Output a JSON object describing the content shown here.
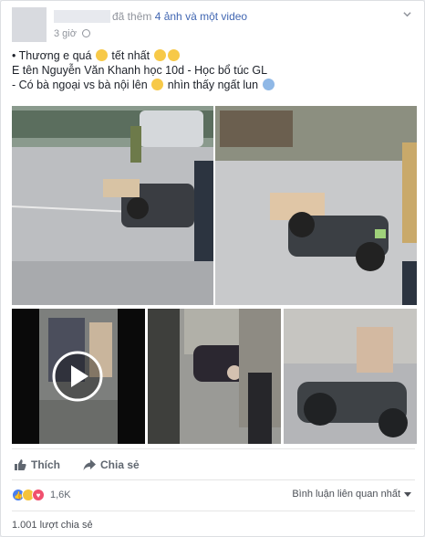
{
  "header": {
    "action_text": "đã thêm",
    "action_link": "4 ảnh và một video",
    "time": "3 giờ"
  },
  "post": {
    "line1_a": "• Thương e quá",
    "line1_b": "tết nhất",
    "line2": "E tên Nguyễn Văn Khanh học 10d - Học bổ túc GL",
    "line3_a": "- Có bà ngoại vs bà nội lên",
    "line3_b": "nhìn thấy ngất lun"
  },
  "actions": {
    "like_label": "Thích",
    "share_label": "Chia sẻ"
  },
  "reactions": {
    "count": "1,6K",
    "sort_label": "Bình luận liên quan nhất"
  },
  "shares": "1.001 lượt chia sẻ",
  "colors": {
    "link": "#4267b2",
    "meta": "#90949c",
    "like": "#4a7ff0",
    "sad": "#f5c33b",
    "love": "#f0506e"
  }
}
